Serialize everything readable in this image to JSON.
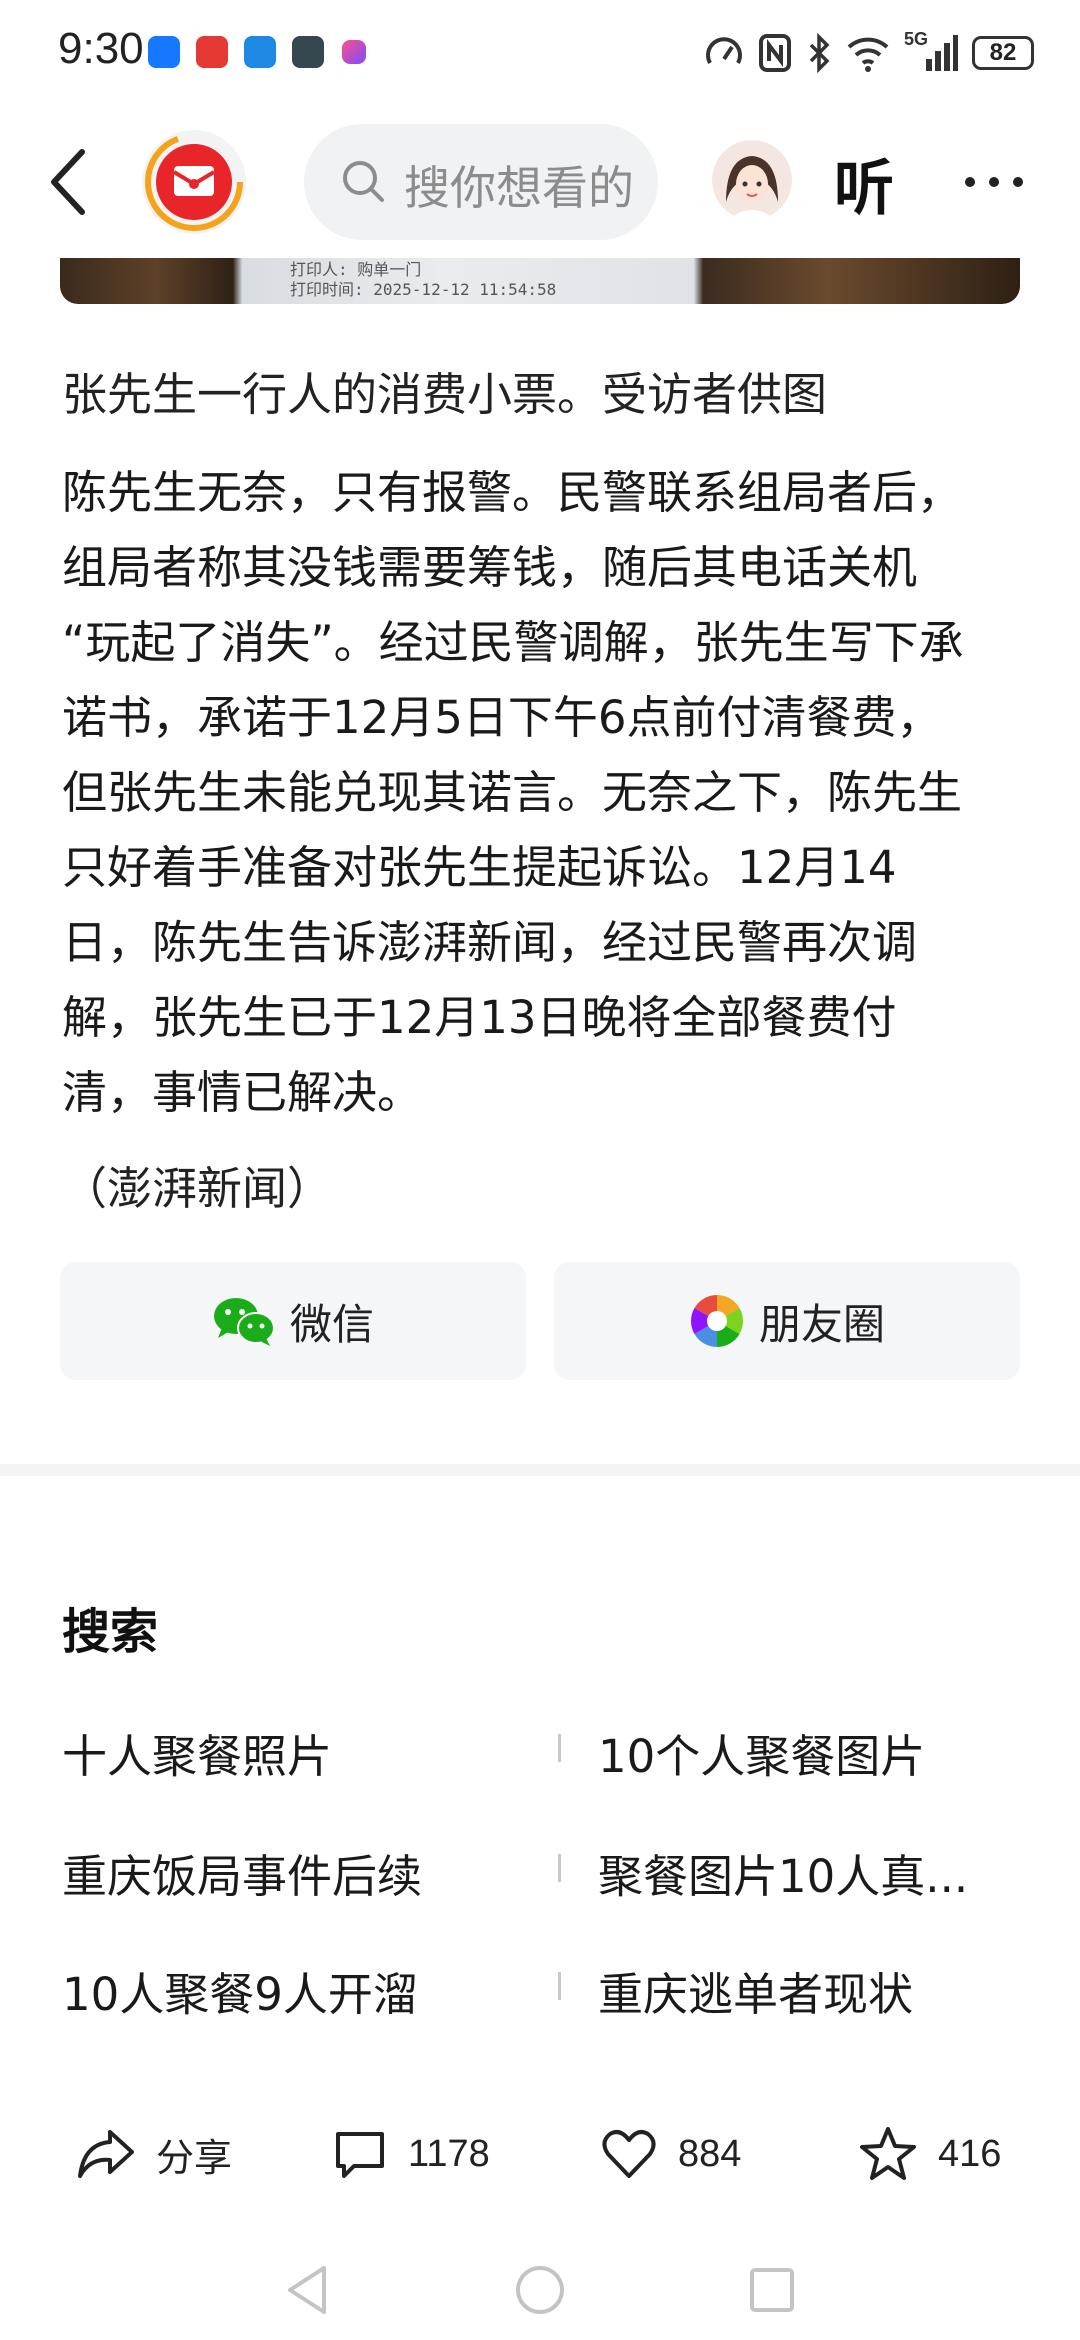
{
  "status_bar": {
    "time": "9:30",
    "battery": "82",
    "network": "5G",
    "icons": [
      "speed-icon",
      "nfc-icon",
      "bluetooth-icon",
      "wifi-icon",
      "signal-icon"
    ]
  },
  "header": {
    "search_placeholder": "搜你想看的",
    "listen_label": "听"
  },
  "image_strip": {
    "receipt_line1": "打印人: 购单一门",
    "receipt_line2": "打印时间: 2025-12-12 11:54:58"
  },
  "article": {
    "caption": "张先生一行人的消费小票。受访者供图",
    "lines": [
      "陈先生无奈，只有报警。民警联系组局者后，",
      "组局者称其没钱需要筹钱，随后其电话关机",
      "“玩起了消失”。经过民警调解，张先生写下承",
      "诺书，承诺于12月5日下午6点前付清餐费，",
      "但张先生未能兑现其诺言。无奈之下，陈先生",
      "只好着手准备对张先生提起诉讼。12月14",
      "日，陈先生告诉澎湃新闻，经过民警再次调",
      "解，张先生已于12月13日晚将全部餐费付",
      "清，事情已解决。"
    ],
    "source": "（澎湃新闻）"
  },
  "share": {
    "wechat_label": "微信",
    "moments_label": "朋友圈"
  },
  "search_section": {
    "heading": "搜索",
    "suggestions": [
      "十人聚餐照片",
      "10个人聚餐图片",
      "重庆饭局事件后续",
      "聚餐图片10人真...",
      "10人聚餐9人开溜",
      "重庆逃单者现状"
    ]
  },
  "actions": {
    "share_label": "分享",
    "comments": "1178",
    "likes": "884",
    "favorites": "416"
  },
  "colors": {
    "wechat_green": "#1aad19",
    "brand_red": "#e8262a",
    "brand_orange": "#f7a21b"
  }
}
